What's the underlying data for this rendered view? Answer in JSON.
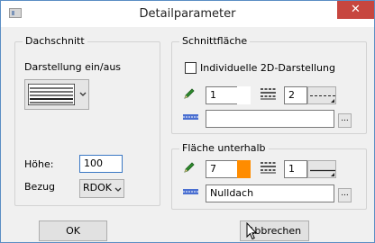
{
  "window": {
    "title": "Detailparameter",
    "close_glyph": "✕"
  },
  "dachschnitt": {
    "legend": "Dachschnitt",
    "darstellung_label": "Darstellung ein/aus",
    "hoehe_label": "Höhe:",
    "hoehe_value": "100",
    "bezug_label": "Bezug",
    "bezug_value": "RDOK"
  },
  "schnittflaeche": {
    "legend": "Schnittfläche",
    "checkbox_label": "Individuelle 2D-Darstellung",
    "checkbox_checked": false,
    "pen_value": "1",
    "line_value": "2",
    "fill_value": "",
    "browse_label": "..."
  },
  "flaeche_unterhalb": {
    "legend": "Fläche unterhalb",
    "pen_value": "7",
    "line_value": "1",
    "fill_value": "Nulldach",
    "browse_label": "...",
    "swatch_color": "#ff8c00"
  },
  "buttons": {
    "ok_label": "OK",
    "cancel_label": "Abbrechen"
  },
  "colors": {
    "accent": "#3b78c4",
    "close": "#c7463f",
    "pencil_green": "#2e8b2e",
    "fill_blue": "#4a6fd1"
  }
}
